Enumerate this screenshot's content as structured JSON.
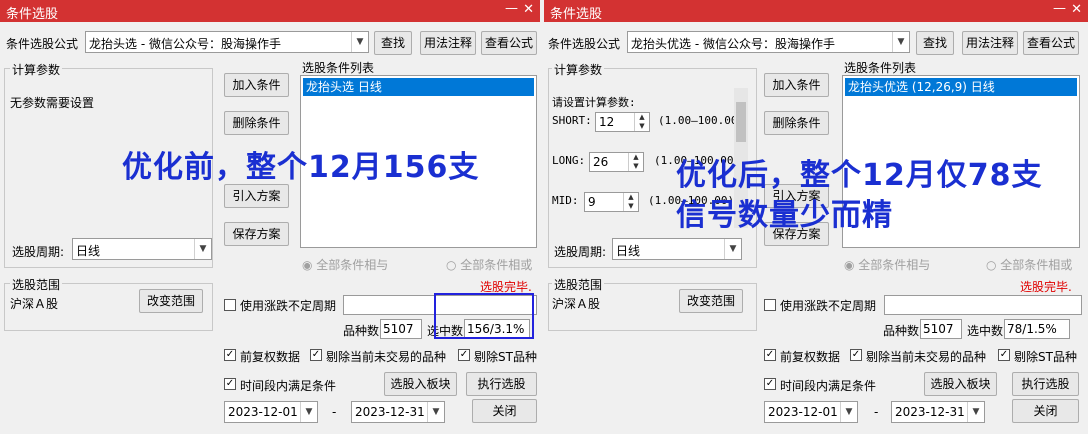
{
  "left": {
    "title": "条件选股",
    "formula_label": "条件选股公式",
    "formula_value": "龙抬头选     - 微信公众号：股海操作手",
    "buttons": {
      "find": "查找",
      "usage": "用法注释",
      "view": "查看公式",
      "add": "加入条件",
      "delete": "删除条件",
      "import": "引入方案",
      "save": "保存方案",
      "change_scope": "改变范围",
      "to_block": "选股入板块",
      "execute": "执行选股",
      "close": "关闭"
    },
    "calc_params_label": "计算参数",
    "no_params": "无参数需要设置",
    "cond_list_label": "选股条件列表",
    "cond_item": "龙抬头选  日线",
    "period_label": "选股周期:",
    "period_value": "日线",
    "radio_and": "全部条件相与",
    "radio_or": "全部条件相或",
    "status": "选股完毕.",
    "scope_label": "选股范围",
    "scope_value": "沪深Ａ股",
    "use_variable_period": "使用涨跌不定周期",
    "count_label": "品种数",
    "count_value": "5107",
    "selected_label": "选中数",
    "selected_value": "156/3.1%",
    "opt1": "前复权数据",
    "opt2": "剔除当前未交易的品种",
    "opt3": "剔除ST品种",
    "opt4": "时间段内满足条件",
    "date_from": "2023-12-01",
    "date_to": "2023-12-31",
    "date_sep": "-",
    "overlay": "优化前，整个12月156支",
    "highlight_color": "#2222dd"
  },
  "right": {
    "title": "条件选股",
    "formula_label": "条件选股公式",
    "formula_value": "龙抬头优选   - 微信公众号：股海操作手",
    "buttons": {
      "find": "查找",
      "usage": "用法注释",
      "view": "查看公式",
      "add": "加入条件",
      "delete": "删除条件",
      "import": "引入方案",
      "save": "保存方案",
      "change_scope": "改变范围",
      "to_block": "选股入板块",
      "execute": "执行选股",
      "close": "关闭"
    },
    "calc_params_label": "计算参数",
    "params_prompt": "请设置计算参数:",
    "params": [
      {
        "name": "SHORT:",
        "value": "12",
        "range": "(1.00—100.00)"
      },
      {
        "name": "LONG:",
        "value": "26",
        "range": "(1.00—100.00)"
      },
      {
        "name": "MID:",
        "value": "9",
        "range": "(1.00—100.00)"
      }
    ],
    "cond_list_label": "选股条件列表",
    "cond_item": "龙抬头优选 (12,26,9) 日线",
    "period_label": "选股周期:",
    "period_value": "日线",
    "radio_and": "全部条件相与",
    "radio_or": "全部条件相或",
    "status": "选股完毕.",
    "scope_label": "选股范围",
    "scope_value": "沪深Ａ股",
    "use_variable_period": "使用涨跌不定周期",
    "count_label": "品种数",
    "count_value": "5107",
    "selected_label": "选中数",
    "selected_value": "78/1.5%",
    "opt1": "前复权数据",
    "opt2": "剔除当前未交易的品种",
    "opt3": "剔除ST品种",
    "opt4": "时间段内满足条件",
    "date_from": "2023-12-01",
    "date_to": "2023-12-31",
    "date_sep": "-",
    "overlay_line1": "优化后，整个12月仅78支",
    "overlay_line2": "信号数量少而精"
  },
  "icons": {
    "minimize": "minimize-icon",
    "close": "close-icon",
    "dropdown": "chevron-down-icon",
    "check": "checkmark-icon"
  }
}
